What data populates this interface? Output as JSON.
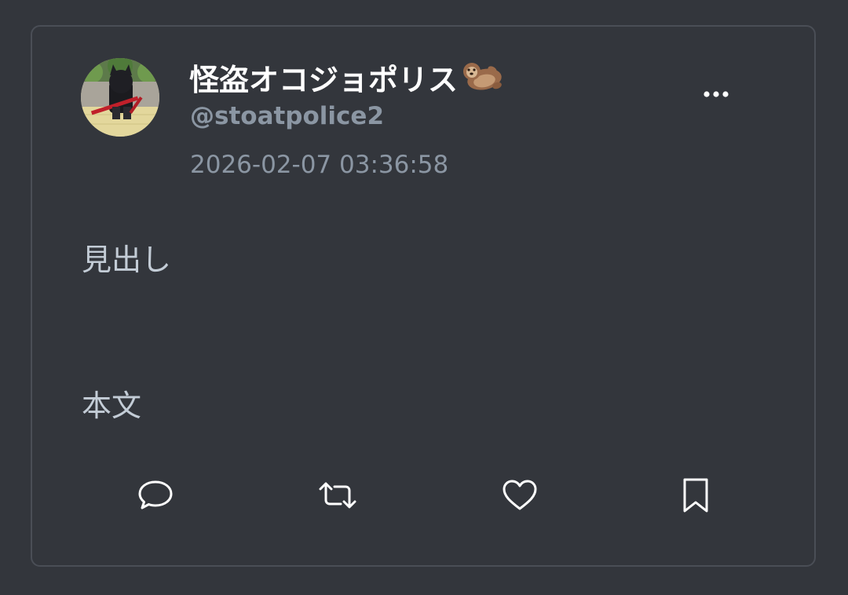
{
  "post": {
    "display_name": "怪盗オコジョポリス",
    "display_name_emoji": "otter-emoji",
    "handle": "@stoatpolice2",
    "timestamp": "2026-02-07 03:36:58",
    "heading": "見出し",
    "body": "本文"
  },
  "actions": {
    "reply_icon": "speech-bubble-icon",
    "repost_icon": "repost-arrows-icon",
    "like_icon": "heart-icon",
    "bookmark_icon": "bookmark-icon",
    "more_icon": "ellipsis-icon"
  },
  "colors": {
    "background": "#33363c",
    "card_border": "#4a4e56",
    "name": "#ffffff",
    "secondary_text": "#8b96a3",
    "body_text": "#c3ccd6",
    "icon": "#ffffff"
  }
}
